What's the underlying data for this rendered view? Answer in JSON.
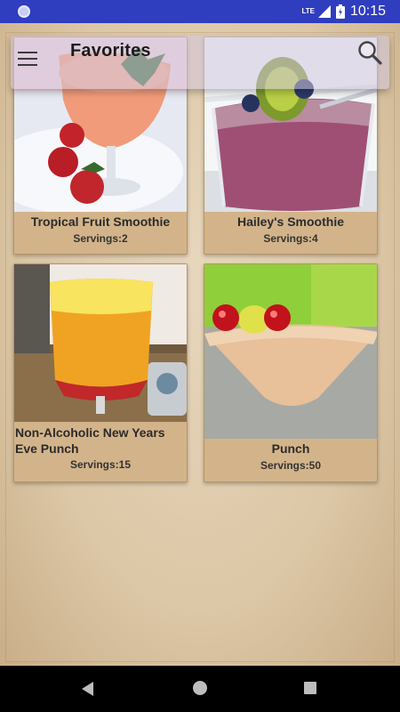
{
  "status_bar": {
    "network": "LTE",
    "time": "10:15"
  },
  "app_bar": {
    "title": "Favorites"
  },
  "recipes": [
    {
      "name": "Tropical Fruit Smoothie",
      "servings": "Servings:2"
    },
    {
      "name": "Hailey's Smoothie",
      "servings": "Servings:4"
    },
    {
      "name": "Non-Alcoholic New Years Eve Punch",
      "servings": "Servings:15"
    },
    {
      "name": "Punch",
      "servings": "Servings:50"
    }
  ],
  "colors": {
    "status_bar": "#2f3dbf",
    "card": "#d3b48a",
    "paper": "#e0cbab"
  }
}
